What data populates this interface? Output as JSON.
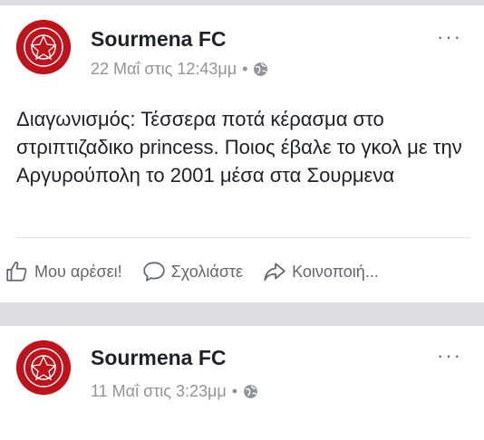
{
  "posts": [
    {
      "author": "Sourmena FC",
      "date": "22 Μαΐ στις 12:43μμ",
      "dot": "•",
      "more": "···",
      "text": "Διαγωνισμός: Τέσσερα ποτά κέρασμα στο στριπτιζαδικο princess.  Ποιος έβαλε το γκολ με την Αργυρούπολη το 2001 μέσα στα Σουρμενα",
      "actions": {
        "like": "Μου αρέσει!",
        "comment": "Σχολιάστε",
        "share": "Κοινοποιή..."
      }
    },
    {
      "author": "Sourmena FC",
      "date": "11 Μαΐ στις 3:23μμ",
      "dot": "•",
      "more": "···"
    }
  ]
}
